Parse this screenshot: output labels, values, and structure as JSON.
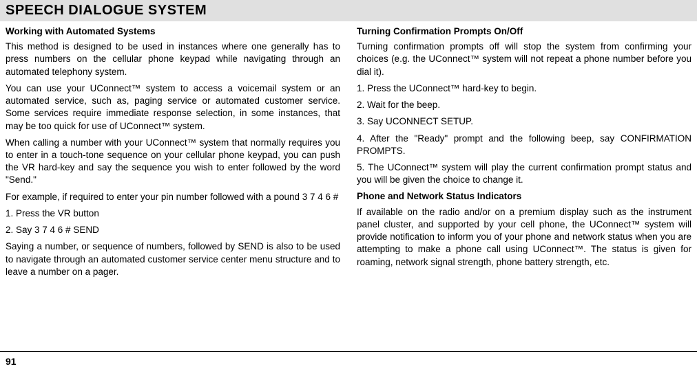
{
  "header": {
    "title": "SPEECH DIALOGUE SYSTEM"
  },
  "left": {
    "h1": "Working with Automated Systems",
    "p1": "This method is designed to be used in instances where one generally has to press numbers on the cellular phone keypad while navigating through an automated telephony system.",
    "p2": "You can use your UConnect™ system to access a voicemail system or an automated service, such as, paging service or automated customer service. Some services require immediate response selection, in some instances, that may be too quick for use of UConnect™ system.",
    "p3": "When calling a number with your UConnect™ system that normally requires you to enter in a touch-tone sequence on your cellular phone keypad, you can push the VR hard-key and say the sequence you wish to enter followed by the word \"Send.\"",
    "p4": "For example, if required to enter your pin number followed with a pound 3 7 4 6 #",
    "p5": "1. Press the VR button",
    "p6": "2. Say 3 7 4 6 # SEND",
    "p7": "Saying a number, or sequence of numbers, followed by SEND is also to be used to navigate through an automated customer service center menu structure and to leave a number on a pager."
  },
  "right": {
    "h1": "Turning Confirmation Prompts On/Off",
    "p1": "Turning confirmation prompts off will stop the system from confirming your choices (e.g. the UConnect™ system will not repeat a phone number before you dial it).",
    "p2": "1. Press the UConnect™ hard-key to begin.",
    "p3": "2. Wait for the beep.",
    "p4": "3. Say UCONNECT SETUP.",
    "p5": "4. After the \"Ready\" prompt and the following beep, say CONFIRMATION PROMPTS.",
    "p6": "5. The UConnect™ system will play the current confirmation prompt status and you will be given the choice to change it.",
    "h2": "Phone and Network Status Indicators",
    "p7": "If available on the radio and/or on a premium display such as the instrument panel cluster, and supported by your cell phone, the UConnect™ system will provide notification to inform you of your phone and network status when you are attempting to make a phone call using UConnect™. The status is given for roaming, network signal strength, phone battery strength, etc."
  },
  "page": {
    "number": "91"
  }
}
